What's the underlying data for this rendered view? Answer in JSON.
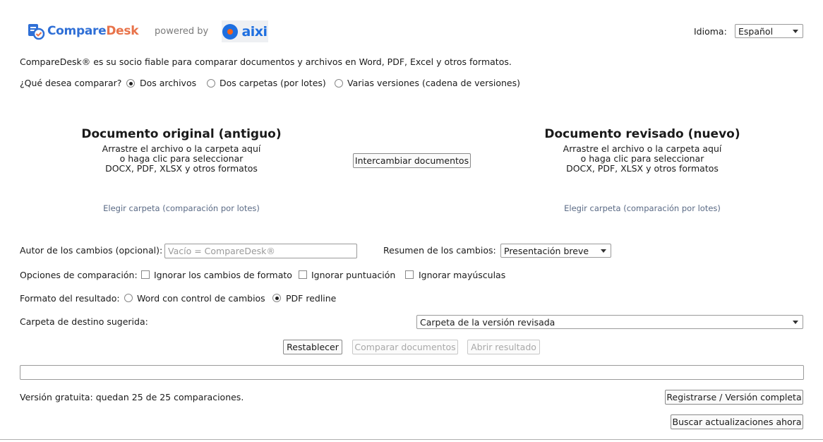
{
  "header": {
    "logo_part1": "Compare",
    "logo_part2": "Desk",
    "powered_by": "powered by",
    "partner_logo": "aixi",
    "language_label": "Idioma:",
    "language_value": "Español"
  },
  "tagline": "CompareDesk® es su socio fiable para comparar documentos y archivos en Word, PDF, Excel y otros formatos.",
  "compare_mode": {
    "question": "¿Qué desea comparar?",
    "options": [
      {
        "label": "Dos archivos",
        "checked": true
      },
      {
        "label": "Dos carpetas (por lotes)",
        "checked": false
      },
      {
        "label": "Varias versiones (cadena de versiones)",
        "checked": false
      }
    ]
  },
  "original_doc": {
    "title": "Documento original (antiguo)",
    "hint_line1": "Arrastre el archivo o la carpeta aquí",
    "hint_line2": "o haga clic para seleccionar",
    "hint_line3": "DOCX, PDF, XLSX y otros formatos",
    "folder_link": "Elegir carpeta (comparación por lotes)"
  },
  "revised_doc": {
    "title": "Documento revisado (nuevo)",
    "hint_line1": "Arrastre el archivo o la carpeta aquí",
    "hint_line2": "o haga clic para seleccionar",
    "hint_line3": "DOCX, PDF, XLSX y otros formatos",
    "folder_link": "Elegir carpeta (comparación por lotes)"
  },
  "swap_button": "Intercambiar documentos",
  "author": {
    "label": "Autor de los cambios (opcional):",
    "placeholder": "Vacío = CompareDesk®",
    "value": ""
  },
  "summary": {
    "label": "Resumen de los cambios:",
    "value": "Presentación breve"
  },
  "compare_options": {
    "label": "Opciones de comparación:",
    "items": [
      {
        "label": "Ignorar los cambios de formato",
        "checked": false
      },
      {
        "label": "Ignorar puntuación",
        "checked": false
      },
      {
        "label": "Ignorar mayúsculas",
        "checked": false
      }
    ]
  },
  "output_format": {
    "label": "Formato del resultado:",
    "options": [
      {
        "label": "Word con control de cambios",
        "checked": false
      },
      {
        "label": "PDF redline",
        "checked": true
      }
    ]
  },
  "destination": {
    "label": "Carpeta de destino sugerida:",
    "value": "Carpeta de la versión revisada"
  },
  "actions": {
    "reset": "Restablecer",
    "compare": "Comparar documentos",
    "open_result": "Abrir resultado"
  },
  "footer": {
    "free_version_text": "Versión gratuita: quedan 25 de 25 comparaciones.",
    "register_button": "Registrarse / Versión completa",
    "check_updates_button": "Buscar actualizaciones ahora"
  },
  "colors": {
    "logo_blue": "#2f6fd6",
    "logo_orange": "#e8734a",
    "link_gray": "#5a6a85"
  }
}
